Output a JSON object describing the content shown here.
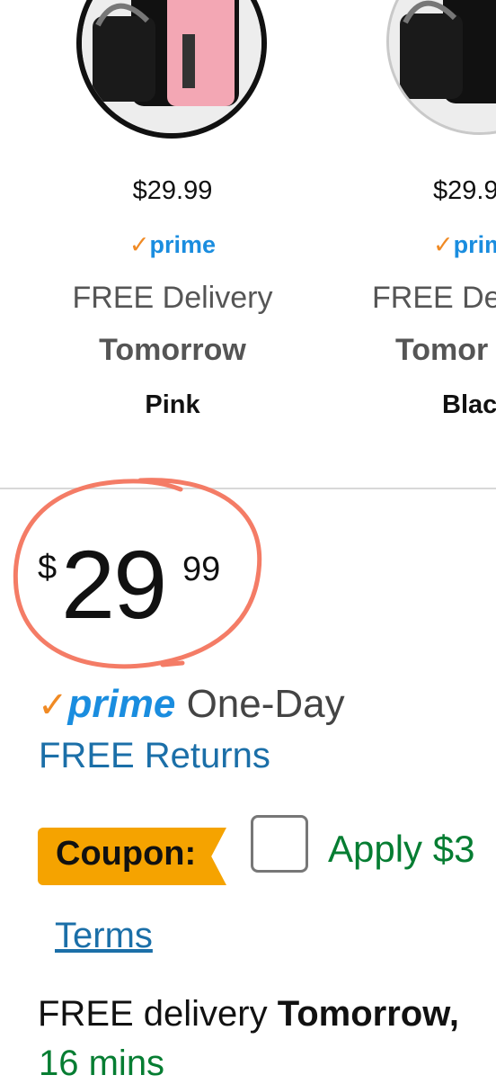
{
  "variants": [
    {
      "price": "$29.99",
      "prime_label": "prime",
      "delivery": "FREE Delivery",
      "day": "Tomorrow",
      "color": "Pink"
    },
    {
      "price": "$29.9",
      "prime_label": "prim",
      "delivery": "FREE De",
      "day": "Tomor",
      "color": "Blac"
    }
  ],
  "price": {
    "currency": "$",
    "whole": "29",
    "fraction": "99"
  },
  "prime": {
    "label": "prime",
    "shipping": "One-Day"
  },
  "returns": "FREE Returns",
  "coupon": {
    "badge": "Coupon:",
    "apply": "Apply $3"
  },
  "terms": "Terms",
  "delivery": {
    "prefix": "FREE delivery",
    "day": "Tomorrow,",
    "countdown": "16 mins"
  },
  "colors": {
    "prime_blue": "#1a8ddf",
    "check_orange": "#f08a24",
    "link_blue": "#1b6fa8",
    "green": "#067d32",
    "coupon_badge": "#f5a300",
    "annotation_circle": "#f47c66"
  }
}
